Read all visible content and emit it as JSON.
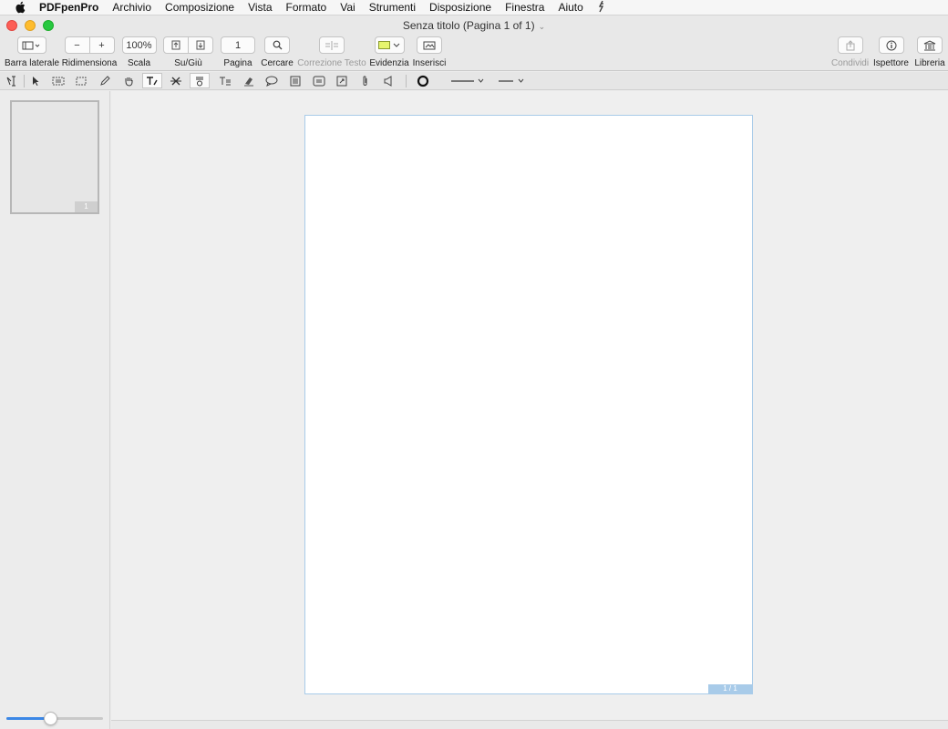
{
  "menubar": {
    "app_name": "PDFpenPro",
    "items": [
      "Archivio",
      "Composizione",
      "Vista",
      "Formato",
      "Vai",
      "Strumenti",
      "Disposizione",
      "Finestra",
      "Aiuto"
    ]
  },
  "window": {
    "title": "Senza titolo (Pagina 1 of 1)"
  },
  "toolbar": {
    "sidebar_label": "Barra laterale",
    "resize_label": "Ridimensiona",
    "resize_minus": "−",
    "resize_plus": "+",
    "scale_value": "100%",
    "scale_label": "Scala",
    "updown_label": "Su/Giù",
    "page_value": "1",
    "page_label": "Pagina",
    "search_label": "Cercare",
    "correction_label": "Correzione Testo",
    "highlight_label": "Evidenzia",
    "highlight_color": "#e6f56e",
    "insert_label": "Inserisci",
    "share_label": "Condividi",
    "inspector_label": "Ispettore",
    "library_label": "Libreria"
  },
  "sidebar": {
    "thumbnail_badge": "1",
    "zoom_slider_value": 0.45
  },
  "document": {
    "page_badge": "1 / 1"
  },
  "colors": {
    "accent": "#3b87e6",
    "page_border": "#a8cbe9"
  }
}
